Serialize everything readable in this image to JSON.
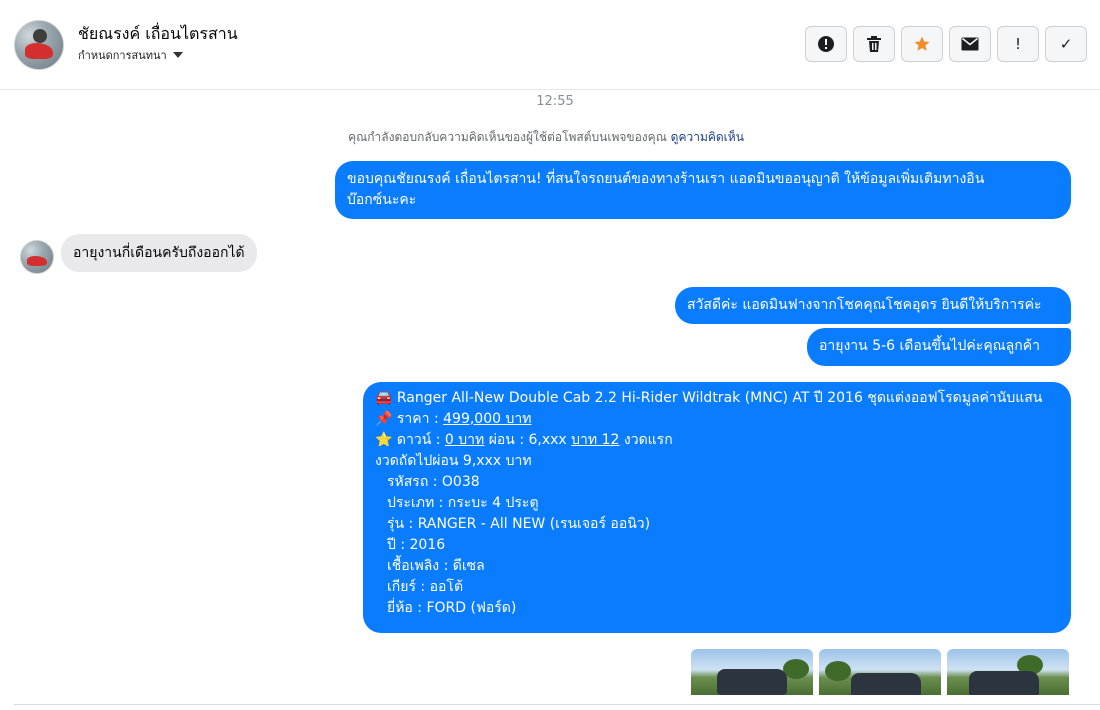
{
  "header": {
    "name": "ชัยณรงค์ เถื่อนไตรสาน",
    "subtitle": "กำหนดการสนทนา",
    "actions": [
      {
        "icon": "alert-circle-icon"
      },
      {
        "icon": "trash-icon"
      },
      {
        "icon": "star-icon",
        "color": "#f28c28"
      },
      {
        "icon": "envelope-icon"
      },
      {
        "icon": "exclamation-icon",
        "label": "!"
      },
      {
        "icon": "checkmark-icon",
        "label": "✓"
      }
    ]
  },
  "chat": {
    "time": "12:55",
    "notice_text": "คุณกำลังตอบกลับความคิดเห็นของผู้ใช้ต่อโพสต์บนเพจของคุณ",
    "notice_link": "ดูความคิดเห็น",
    "messages": {
      "out1_line1": "ขอบคุณชัยณรงค์ เถื่อนไตรสาน! ที่สนใจรถยนต์ของทางร้านเรา แอดมินขออนุญาติ ให้ข้อมูลเพิ่มเติมทางอิน",
      "out1_line2": "บ๊อกซ์นะคะ",
      "in1": "อายุงานกี่เดือนครับถึงออกได้",
      "out2": "สวัสดีค่ะ แอดมินฟางจากโชคคุณโชคอุดร ยินดีให้บริการค่ะ",
      "out3": "อายุงาน  5-6  เดือนขึ้นไปค่ะคุณลูกค้า",
      "listing": {
        "car_emoji": "🚘",
        "title": "Ranger All-New Double Cab 2.2 Hi-Rider Wildtrak (MNC) AT ปี 2016 ชุดแต่งออฟโรดมูลค่านับแสน",
        "pin_emoji": "📌",
        "price_label": "ราคา : ",
        "price_value": "499,000 บาท",
        "star_emoji": "⭐",
        "down_label": "ดาวน์ : ",
        "down_value": "0 บาท",
        "installment_label": " ผ่อน : 6,xxx ",
        "installment_value": "บาท 12",
        "first_term": " งวดแรก",
        "next_term": "งวดถัดไปผ่อน  9,xxx บาท",
        "code": "รหัสรถ : O038",
        "type": "ประเภท : กระบะ 4 ประตู",
        "model": "รุ่น : RANGER - All NEW (เรนเจอร์ ออนิว)",
        "year": "ปี : 2016",
        "fuel": "เชื้อเพลิง : ดีเซล",
        "gear": "เกียร์ : ออโต้",
        "brand": "ยี่ห้อ : FORD (ฟอร์ด)"
      }
    },
    "colors": {
      "outgoing_bubble": "#0a7cff",
      "incoming_bubble": "#e9e9eb",
      "link": "#1d3f8a"
    }
  }
}
